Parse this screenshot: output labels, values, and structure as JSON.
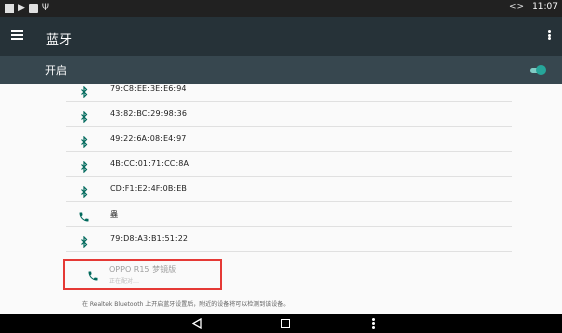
{
  "status_bar": {
    "left_icons": [
      "photo-icon",
      "cast-icon",
      "square-icon",
      "usb-icon"
    ],
    "arrows_glyph": "<>",
    "time": "11:07"
  },
  "app_bar": {
    "title": "蓝牙"
  },
  "toggle": {
    "label": "开启",
    "state": "on",
    "accent_color": "#26a69a"
  },
  "devices": [
    {
      "name": "79:C8:EE:3E:E6:94",
      "icon": "bluetooth-icon"
    },
    {
      "name": "43:82:BC:29:98:36",
      "icon": "bluetooth-icon"
    },
    {
      "name": "49:22:6A:08:E4:97",
      "icon": "bluetooth-icon"
    },
    {
      "name": "4B:CC:01:71:CC:8A",
      "icon": "bluetooth-icon"
    },
    {
      "name": "CD:F1:E2:4F:0B:EB",
      "icon": "bluetooth-icon"
    },
    {
      "name": "蟲",
      "icon": "phone-icon"
    },
    {
      "name": "79:D8:A3:B1:51:22",
      "icon": "bluetooth-icon"
    }
  ],
  "pairing_device": {
    "name": "OPPO R15 梦镜版",
    "status": "正在配对…",
    "icon": "phone-icon",
    "highlight_color": "#e53935"
  },
  "footer_note": "在 Realtek Bluetooth 上开启蓝牙设置后，附近的设备将可以检测到该设备。"
}
